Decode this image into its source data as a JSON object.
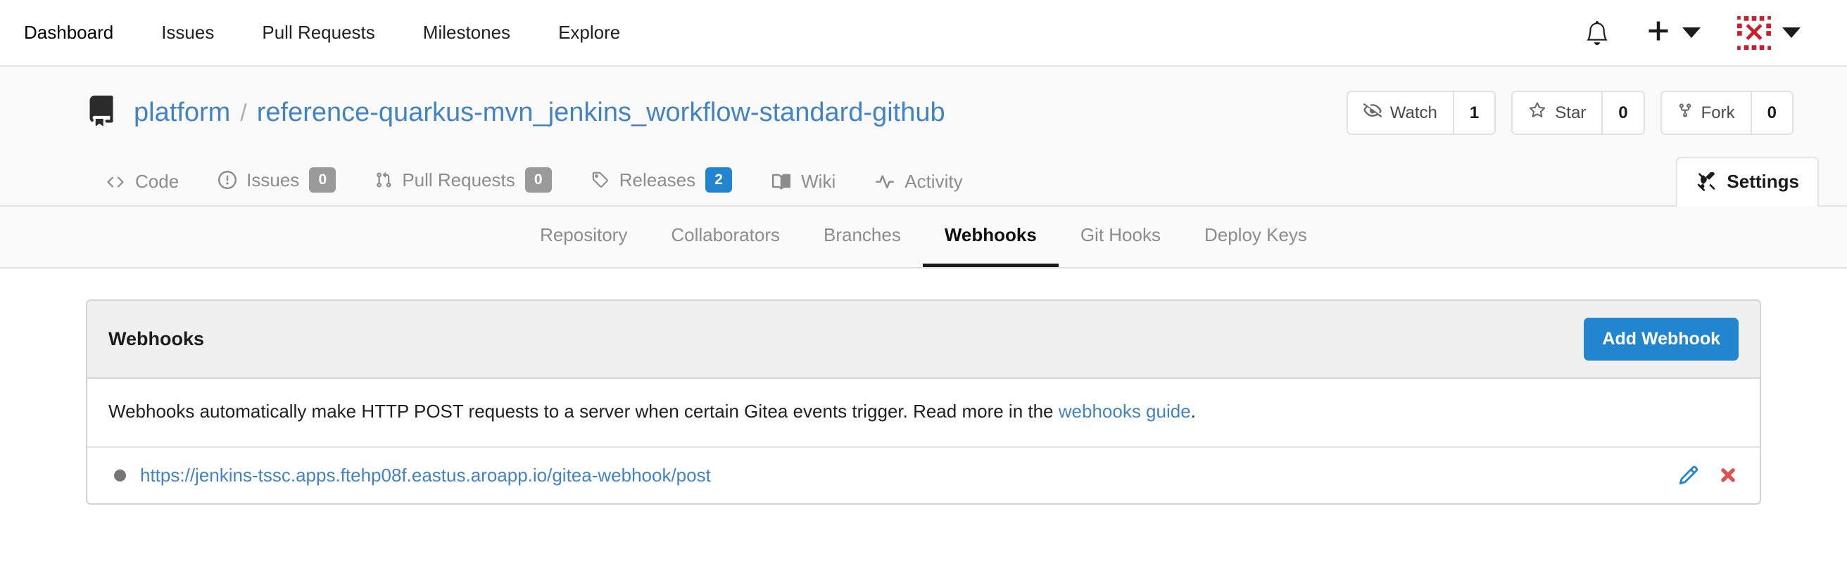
{
  "topnav": {
    "links": [
      {
        "label": "Dashboard"
      },
      {
        "label": "Issues"
      },
      {
        "label": "Pull Requests"
      },
      {
        "label": "Milestones"
      },
      {
        "label": "Explore"
      }
    ],
    "icons": {
      "notifications": "bell-icon",
      "create": "plus-icon",
      "create_caret": "chevron-down-icon",
      "avatar": "identicon-avatar",
      "avatar_caret": "chevron-down-icon"
    },
    "avatar_color": "#cc1f2e"
  },
  "repo": {
    "icon": "repo-book-icon",
    "owner": "platform",
    "separator": "/",
    "name": "reference-quarkus-mvn_jenkins_workflow-standard-github",
    "actions": [
      {
        "icon": "eye-slash-icon",
        "label": "Watch",
        "count": "1"
      },
      {
        "icon": "star-icon",
        "label": "Star",
        "count": "0"
      },
      {
        "icon": "fork-icon",
        "label": "Fork",
        "count": "0"
      }
    ],
    "tabs": [
      {
        "icon": "code-icon",
        "label": "Code",
        "badge": null,
        "active": false
      },
      {
        "icon": "issue-opened-icon",
        "label": "Issues",
        "badge": "0",
        "badge_color": "gray",
        "active": false
      },
      {
        "icon": "git-pull-request-icon",
        "label": "Pull Requests",
        "badge": "0",
        "badge_color": "gray",
        "active": false
      },
      {
        "icon": "tag-icon",
        "label": "Releases",
        "badge": "2",
        "badge_color": "blue",
        "active": false
      },
      {
        "icon": "book-icon",
        "label": "Wiki",
        "badge": null,
        "active": false
      },
      {
        "icon": "pulse-icon",
        "label": "Activity",
        "badge": null,
        "active": false
      },
      {
        "icon": "tools-icon",
        "label": "Settings",
        "badge": null,
        "active": true
      }
    ]
  },
  "settings_subnav": {
    "items": [
      {
        "label": "Repository",
        "active": false
      },
      {
        "label": "Collaborators",
        "active": false
      },
      {
        "label": "Branches",
        "active": false
      },
      {
        "label": "Webhooks",
        "active": true
      },
      {
        "label": "Git Hooks",
        "active": false
      },
      {
        "label": "Deploy Keys",
        "active": false
      }
    ]
  },
  "webhooks_panel": {
    "title": "Webhooks",
    "add_button": "Add Webhook",
    "description_before": "Webhooks automatically make HTTP POST requests to a server when certain Gitea events trigger. Read more in the ",
    "description_link": "webhooks guide",
    "description_after": ".",
    "hooks": [
      {
        "status": "inactive",
        "status_color": "#767676",
        "url": "https://jenkins-tssc.apps.ftehp08f.eastus.aroapp.io/gitea-webhook/post",
        "edit_icon": "pencil-icon",
        "delete_icon": "close-x-icon",
        "edit_color": "#2185d0",
        "delete_color": "#db5252"
      }
    ]
  },
  "colors": {
    "link": "#4183c4",
    "primary": "#2185d0",
    "badge_gray": "#9a9a9a",
    "panel_head_bg": "#f0f0f0",
    "border": "#d4d4d5"
  }
}
